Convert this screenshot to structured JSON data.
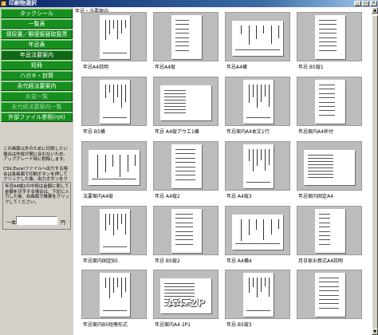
{
  "window": {
    "title": "印刷物選択"
  },
  "menu": [
    {
      "label": "タックシール",
      "state": "normal"
    },
    {
      "label": "一覧表",
      "state": "normal"
    },
    {
      "label": "領収書／郵便振替取扱票",
      "state": "normal"
    },
    {
      "label": "年忌表",
      "state": "normal"
    },
    {
      "label": "年忌法要案内",
      "state": "normal"
    },
    {
      "label": "短冊",
      "state": "normal"
    },
    {
      "label": "ハガキ・封筒",
      "state": "normal"
    },
    {
      "label": "永代経法要案内",
      "state": "normal"
    },
    {
      "label": "お盆一覧",
      "state": "disabled"
    },
    {
      "label": "永代経法要案内一覧",
      "state": "disabled"
    },
    {
      "label": "外部ファイル参照(rpt)",
      "state": "normal"
    }
  ],
  "notes": {
    "note1": "この画面以外のために印刷したい場合は作成が間に合わないため、アップグレード時に削除します。",
    "note2": "CSV,Excelファイルへ出力する場合は各画面で印刷ボタンを押してクリックした後、出力ボタンをクリックしてください。"
  },
  "memo": {
    "text": "年忌A4縦2の中段は金額に関して金額を印字する場合は、下記に入力した後、右画面で帳票をクリックしてください。",
    "count_label": "一本",
    "price_value": "",
    "unit": "円"
  },
  "section_header": "年忌・法要案内",
  "thumbnails": [
    {
      "caption": "年忌A4説明"
    },
    {
      "caption": "年忌A4縦"
    },
    {
      "caption": "年忌A4横"
    },
    {
      "caption": "年忌 B5縦1"
    },
    {
      "caption": "年忌 B5横"
    },
    {
      "caption": "年忌 A4縦アウエ1横"
    },
    {
      "caption": "年忌案内A4本文1行"
    },
    {
      "caption": "年忌案内A4枠付"
    },
    {
      "caption": "法要案内A4縦"
    },
    {
      "caption": "年忌 A4縦2"
    },
    {
      "caption": "年忌 A4縦3"
    },
    {
      "caption": "年忌案内固定A4"
    },
    {
      "caption": "年忌案内固定B5"
    },
    {
      "caption": "年忌 B5縦2"
    },
    {
      "caption": "年忌 A4横4"
    },
    {
      "caption": "月日家お葬式A4説明"
    },
    {
      "caption": "年忌案内B5短冊形式"
    },
    {
      "caption": "年忌案内A4 2P1",
      "overlay": "A4-2P"
    },
    {
      "caption": "年忌 B5縦3"
    },
    {
      "caption": ""
    }
  ],
  "icons": {
    "app": "folder-icon",
    "minimize": "minimize-icon",
    "maximize": "maximize-icon",
    "close": "close-icon"
  },
  "colors": {
    "menu_green": "#168f1f",
    "title_bar": "#0a246a"
  }
}
